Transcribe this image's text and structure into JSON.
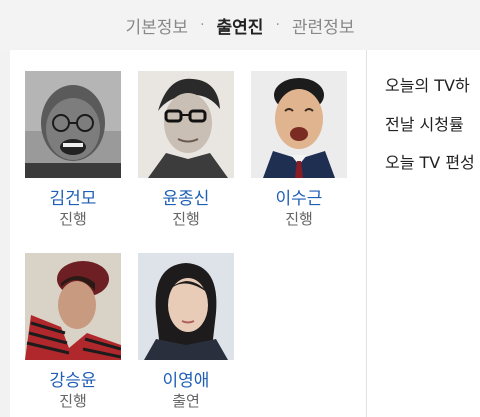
{
  "tabs": [
    {
      "label": "기본정보",
      "active": false
    },
    {
      "label": "출연진",
      "active": true
    },
    {
      "label": "관련정보",
      "active": false
    }
  ],
  "tab_separator": "·",
  "cast": [
    {
      "name": "김건모",
      "role": "진행"
    },
    {
      "name": "윤종신",
      "role": "진행"
    },
    {
      "name": "이수근",
      "role": "진행"
    },
    {
      "name": "강승윤",
      "role": "진행"
    },
    {
      "name": "이영애",
      "role": "출연"
    }
  ],
  "side_links": [
    {
      "label": "오늘의 TV하"
    },
    {
      "label": "전날 시청률"
    },
    {
      "label": "오늘 TV 편성"
    }
  ],
  "colors": {
    "name_link": "#1f5fb6",
    "active_tab": "#222222",
    "inactive_tab": "#888888"
  }
}
